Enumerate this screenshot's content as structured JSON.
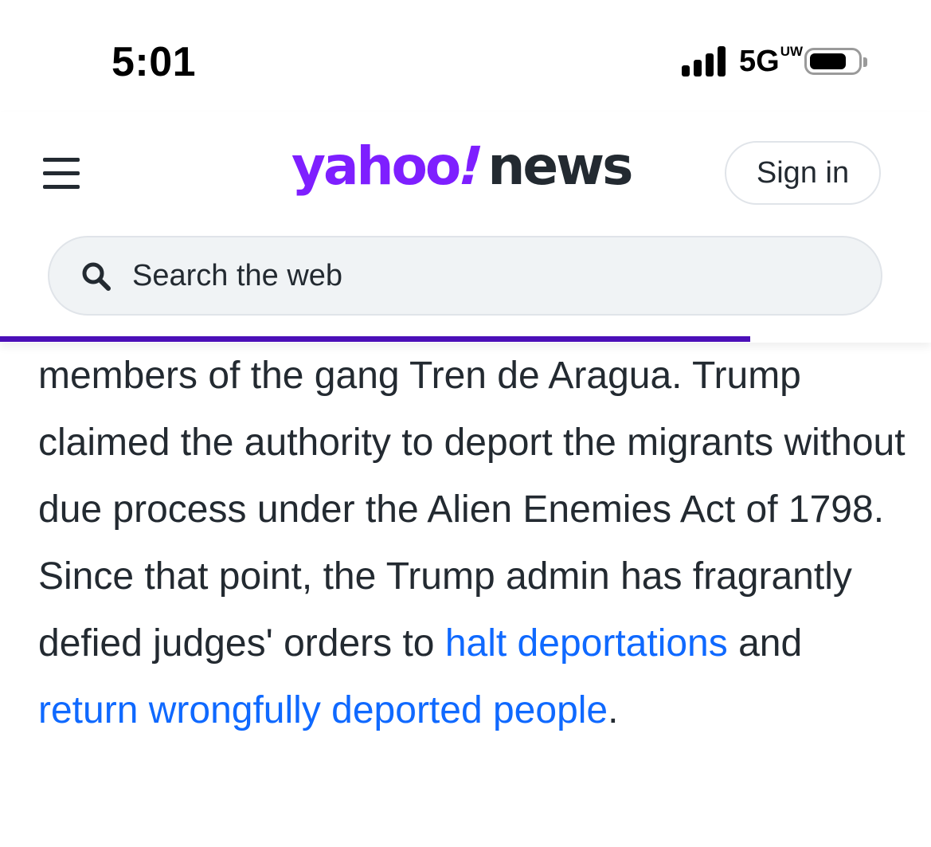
{
  "status_bar": {
    "time": "5:01",
    "network": "5G",
    "network_badge": "UW",
    "signal_bars": 4,
    "battery_level": 0.75
  },
  "header": {
    "logo_yahoo": "yahoo",
    "logo_bang": "!",
    "logo_news": "news",
    "sign_in_label": "Sign in",
    "menu_icon": "hamburger-menu-icon",
    "brand_color": "#7e1fff"
  },
  "search": {
    "placeholder": "Search the web",
    "icon": "search-icon"
  },
  "reading_progress": 0.806,
  "article": {
    "text_before": "members of the gang Tren de Aragua. Trump claimed the authority to deport the migrants without due process under the Alien Enemies Act of 1798. Since that point, the Trump admin has fragrantly defied judges' orders to ",
    "link1": "halt deportations",
    "text_middle": " and ",
    "link2": "return wrongfully deported people",
    "text_after": ".",
    "link_color": "#0f69ff"
  }
}
